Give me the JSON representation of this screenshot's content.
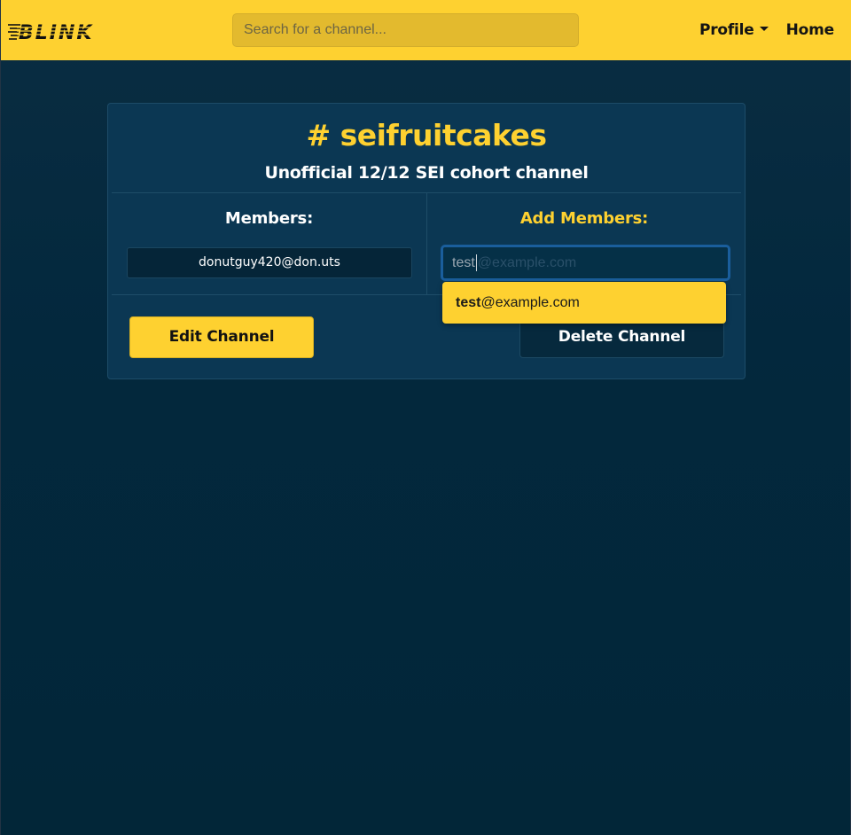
{
  "navbar": {
    "logo_text": "BLINK",
    "search_placeholder": "Search for a channel...",
    "profile_label": "Profile",
    "home_label": "Home",
    "colors": {
      "background": "#fed130",
      "text": "#141414"
    }
  },
  "channel": {
    "name": "# seifruitcakes",
    "description": "Unofficial 12/12 SEI cohort channel"
  },
  "members": {
    "label": "Members:",
    "items": [
      "donutguy420@don.uts"
    ]
  },
  "add_members": {
    "label": "Add Members:",
    "typed_value": "test",
    "autocomplete_hint": "@example.com",
    "suggestion_match": "test",
    "suggestion_rest": "@example.com"
  },
  "actions": {
    "edit_label": "Edit Channel",
    "delete_label": "Delete Channel"
  },
  "colors": {
    "accent": "#fed130",
    "background": "#03283d",
    "card": "#0b3753"
  }
}
